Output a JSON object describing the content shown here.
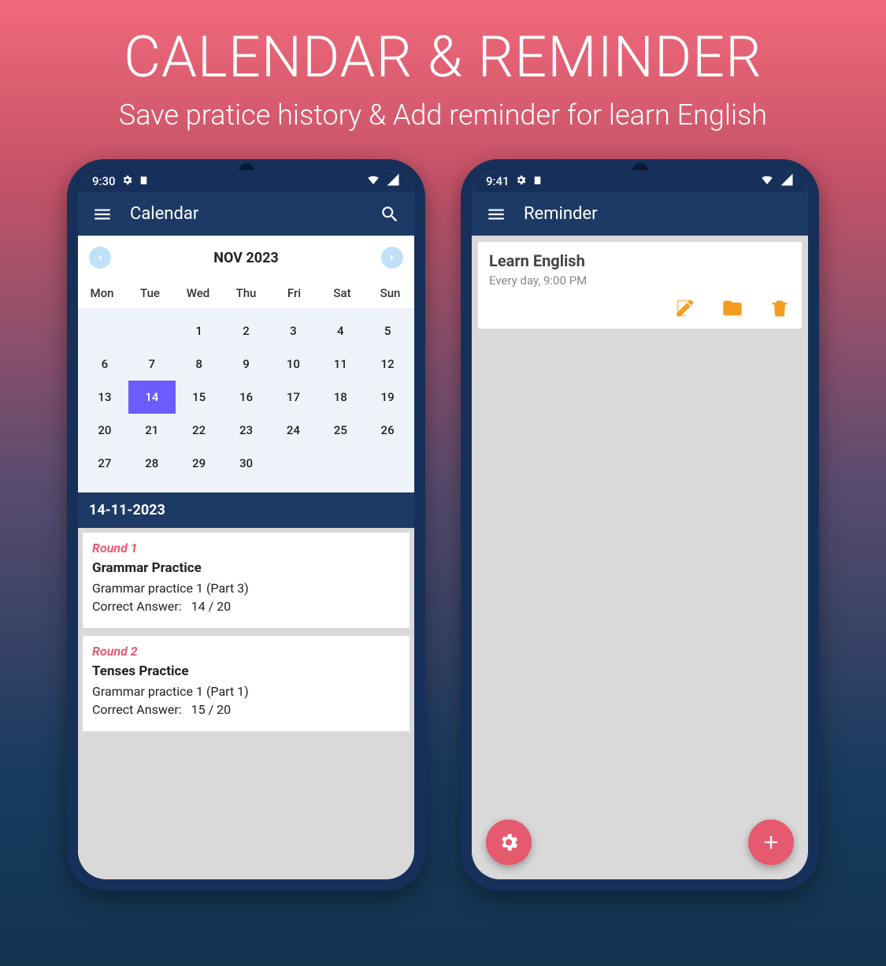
{
  "hero": {
    "title": "CALENDAR & REMINDER",
    "subtitle": "Save pratice history & Add reminder for learn English"
  },
  "phone1": {
    "status_time": "9:30",
    "app_title": "Calendar",
    "calendar": {
      "month_label": "NOV 2023",
      "dow": [
        "Mon",
        "Tue",
        "Wed",
        "Thu",
        "Fri",
        "Sat",
        "Sun"
      ],
      "weeks": [
        [
          "",
          "",
          "1",
          "2",
          "3",
          "4",
          "5"
        ],
        [
          "6",
          "7",
          "8",
          "9",
          "10",
          "11",
          "12"
        ],
        [
          "13",
          "14",
          "15",
          "16",
          "17",
          "18",
          "19"
        ],
        [
          "20",
          "21",
          "22",
          "23",
          "24",
          "25",
          "26"
        ],
        [
          "27",
          "28",
          "29",
          "30",
          "",
          "",
          ""
        ]
      ],
      "selected_day": "14"
    },
    "selected_date_label": "14-11-2023",
    "rounds": [
      {
        "round": "Round 1",
        "title": "Grammar Practice",
        "detail": "Grammar practice 1 (Part 3)",
        "correct_label": "Correct Answer:",
        "score": "14 / 20"
      },
      {
        "round": "Round 2",
        "title": "Tenses Practice",
        "detail": "Grammar practice 1 (Part 1)",
        "correct_label": "Correct Answer:",
        "score": "15 / 20"
      }
    ]
  },
  "phone2": {
    "status_time": "9:41",
    "app_title": "Reminder",
    "reminder": {
      "title": "Learn English",
      "schedule": "Every day, 9:00 PM"
    }
  }
}
